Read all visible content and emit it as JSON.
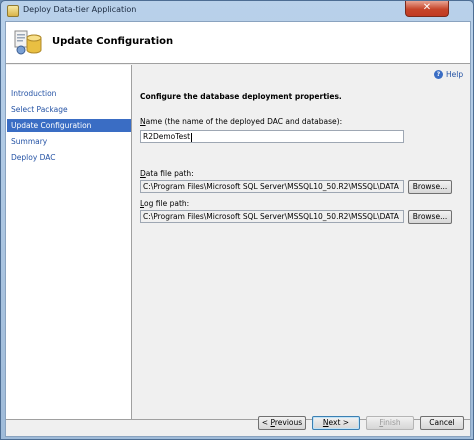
{
  "window": {
    "title": "Deploy Data-tier Application",
    "close_label": "✕"
  },
  "header": {
    "title": "Update Configuration",
    "icon": "wizard-package-icon"
  },
  "sidebar": {
    "items": [
      {
        "label": "Introduction",
        "selected": false
      },
      {
        "label": "Select Package",
        "selected": false
      },
      {
        "label": "Update Configuration",
        "selected": true
      },
      {
        "label": "Summary",
        "selected": false
      },
      {
        "label": "Deploy DAC",
        "selected": false
      }
    ]
  },
  "help": {
    "label": "Help",
    "icon": "help-icon"
  },
  "main": {
    "instruction": "Configure the database deployment properties.",
    "name_field": {
      "label_acc": "N",
      "label_rest": "ame (the name of the deployed DAC and database):",
      "value": "R2DemoTest"
    },
    "data_file": {
      "label_acc": "D",
      "label_rest": "ata file path:",
      "value": "C:\\Program Files\\Microsoft SQL Server\\MSSQL10_50.R2\\MSSQL\\DATA",
      "browse_label": "Browse..."
    },
    "log_file": {
      "label_acc": "L",
      "label_rest": "og file path:",
      "value": "C:\\Program Files\\Microsoft SQL Server\\MSSQL10_50.R2\\MSSQL\\DATA",
      "browse_label": "Browse..."
    }
  },
  "footer": {
    "previous": {
      "pre": "< ",
      "acc": "P",
      "rest": "revious"
    },
    "next": {
      "acc": "N",
      "rest": "ext >"
    },
    "finish": {
      "acc": "F",
      "rest": "inish"
    },
    "cancel": "Cancel"
  }
}
